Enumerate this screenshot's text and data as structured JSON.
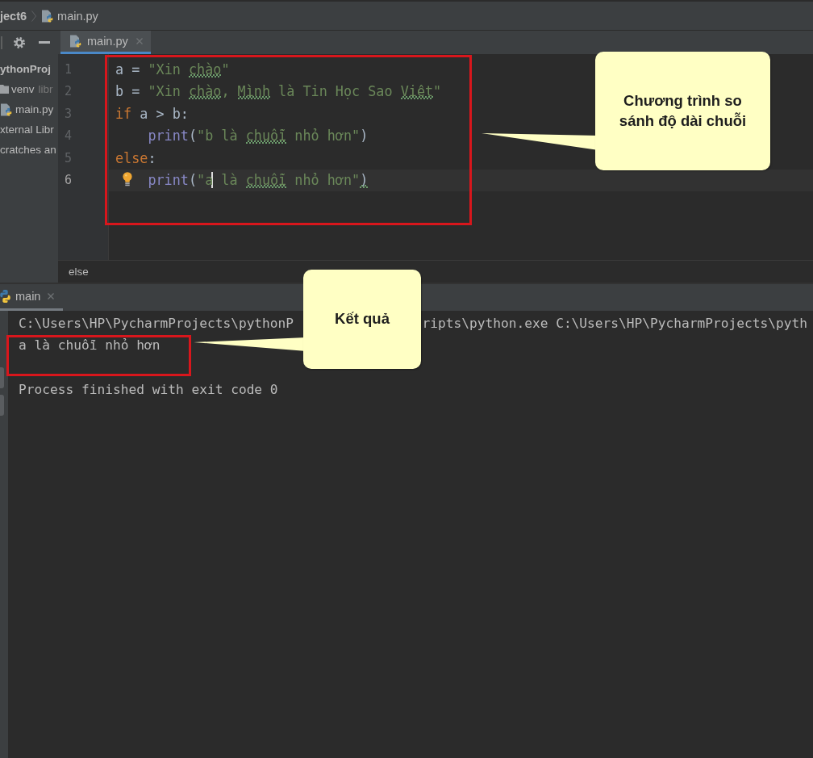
{
  "breadcrumbs": [
    {
      "label": "ject6",
      "kind": "project"
    },
    {
      "label": "main.py",
      "kind": "python_file"
    }
  ],
  "project_panel": {
    "tree": [
      {
        "label": "ythonProj",
        "kind": "project",
        "children": [
          {
            "label": "venv",
            "note": "libr",
            "kind": "folder"
          },
          {
            "label": "main.py",
            "kind": "python_file"
          }
        ]
      },
      {
        "label": "xternal Libr",
        "kind": "library"
      },
      {
        "label": "cratches an",
        "kind": "scratches"
      }
    ]
  },
  "editor": {
    "tabs": [
      {
        "label": "main.py",
        "selected": true
      }
    ],
    "lines": [
      {
        "number": "1",
        "current": false,
        "bulb": false,
        "tokens": [
          {
            "text": "a = ",
            "kind": "plain",
            "squiggly": false,
            "caret": false
          },
          {
            "text": "\"Xin ",
            "kind": "string",
            "squiggly": false,
            "caret": false
          },
          {
            "text": "chào",
            "kind": "string",
            "squiggly": true,
            "caret": false
          },
          {
            "text": "\"",
            "kind": "string",
            "squiggly": false,
            "caret": false
          }
        ]
      },
      {
        "number": "2",
        "current": false,
        "bulb": false,
        "tokens": [
          {
            "text": "b = ",
            "kind": "plain",
            "squiggly": false,
            "caret": false
          },
          {
            "text": "\"Xin ",
            "kind": "string",
            "squiggly": false,
            "caret": false
          },
          {
            "text": "chào",
            "kind": "string",
            "squiggly": true,
            "caret": false
          },
          {
            "text": ", ",
            "kind": "string",
            "squiggly": false,
            "caret": false
          },
          {
            "text": "Mình",
            "kind": "string",
            "squiggly": true,
            "caret": false
          },
          {
            "text": " là Tin Học Sao ",
            "kind": "string",
            "squiggly": false,
            "caret": false
          },
          {
            "text": "Việt",
            "kind": "string",
            "squiggly": true,
            "caret": false
          },
          {
            "text": "\"",
            "kind": "string",
            "squiggly": false,
            "caret": false
          }
        ]
      },
      {
        "number": "3",
        "current": false,
        "bulb": false,
        "tokens": [
          {
            "text": "if",
            "kind": "keyword",
            "squiggly": false,
            "caret": false
          },
          {
            "text": " a > b:",
            "kind": "plain",
            "squiggly": false,
            "caret": false
          }
        ],
        "children": [
          {
            "number": "4",
            "current": false,
            "bulb": false,
            "tokens": [
              {
                "text": "print",
                "kind": "builtin",
                "squiggly": false,
                "caret": false
              },
              {
                "text": "(",
                "kind": "plain",
                "squiggly": false,
                "caret": false
              },
              {
                "text": "\"b là ",
                "kind": "string",
                "squiggly": false,
                "caret": false
              },
              {
                "text": "chuỗi",
                "kind": "string",
                "squiggly": true,
                "caret": false
              },
              {
                "text": " nhỏ hơn\"",
                "kind": "string",
                "squiggly": false,
                "caret": false
              },
              {
                "text": ")",
                "kind": "plain",
                "squiggly": false,
                "caret": false
              }
            ]
          }
        ]
      },
      {
        "number": "5",
        "current": false,
        "bulb": false,
        "tokens": [
          {
            "text": "else",
            "kind": "keyword",
            "squiggly": false,
            "caret": false
          },
          {
            "text": ":",
            "kind": "plain",
            "squiggly": false,
            "caret": false
          }
        ],
        "children": [
          {
            "number": "6",
            "current": true,
            "bulb": true,
            "tokens": [
              {
                "text": "print",
                "kind": "builtin",
                "squiggly": false,
                "caret": false
              },
              {
                "text": "(",
                "kind": "plain",
                "squiggly": false,
                "caret": false
              },
              {
                "text": "\"a",
                "kind": "string",
                "squiggly": false,
                "caret": true
              },
              {
                "text": " là ",
                "kind": "string",
                "squiggly": false,
                "caret": false
              },
              {
                "text": "chuỗi",
                "kind": "string",
                "squiggly": true,
                "caret": false
              },
              {
                "text": " nhỏ hơn\"",
                "kind": "string",
                "squiggly": false,
                "caret": false
              },
              {
                "text": ")",
                "kind": "plain",
                "squiggly": true,
                "caret": false
              }
            ]
          }
        ]
      }
    ],
    "breadcrumb": "else",
    "callout": "Chương trình so\nsánh độ dài chuỗi"
  },
  "run_window": {
    "tabs": [
      {
        "label": "main",
        "selected": true
      }
    ],
    "console": {
      "command_parts": [
        "C:\\Users\\HP\\PycharmProjects\\pythonP",
        "ripts\\python.exe C:\\Users\\HP\\PycharmProjects\\pyth"
      ],
      "output": "a là chuỗi nhỏ hơn",
      "exit_message": "Process finished with exit code 0"
    },
    "callout": "Kết quả"
  }
}
